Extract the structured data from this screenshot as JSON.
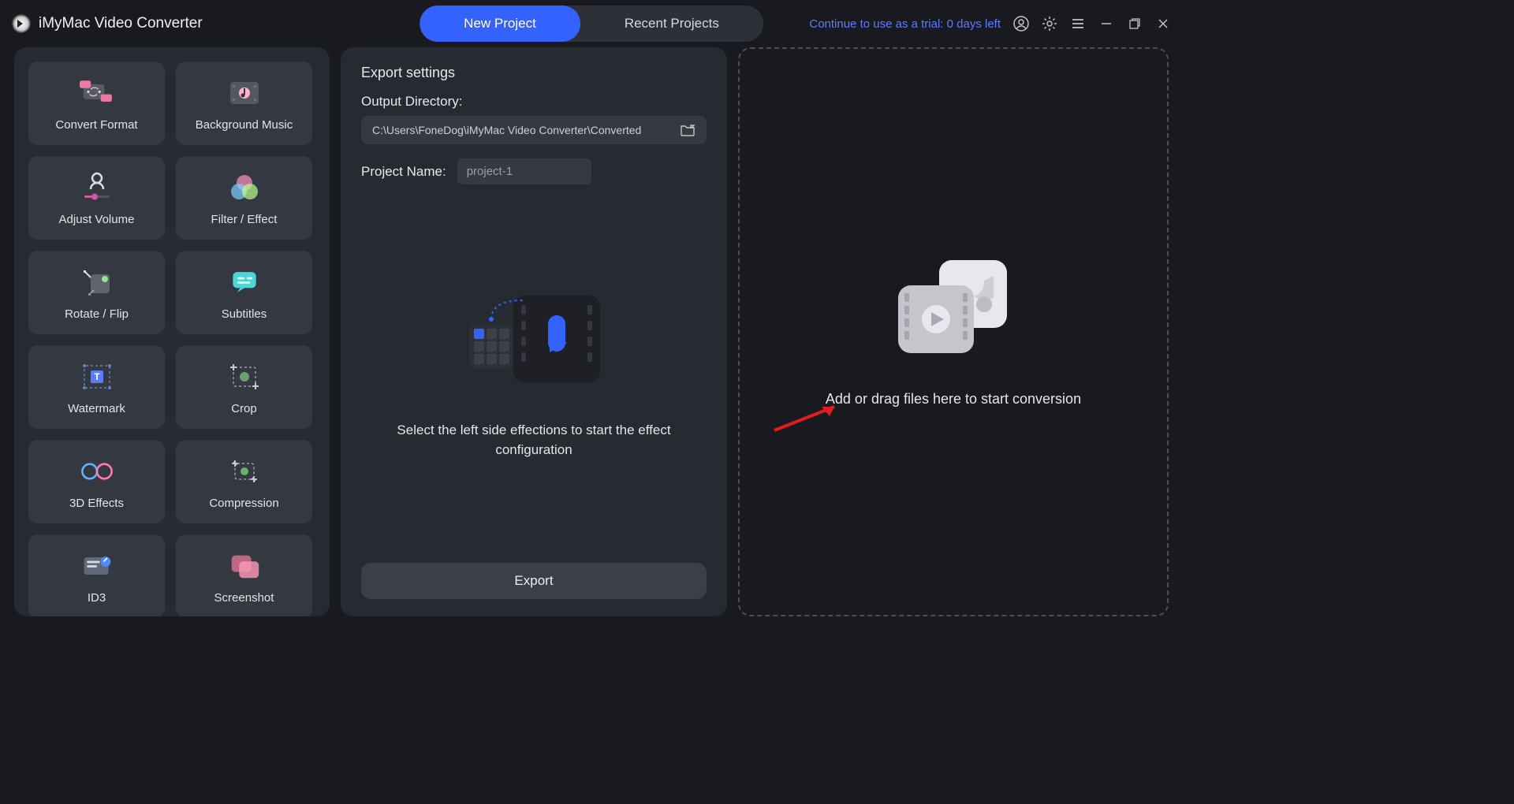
{
  "app": {
    "title": "iMyMac Video Converter"
  },
  "tabs": {
    "new_project": "New Project",
    "recent_projects": "Recent Projects"
  },
  "trial": {
    "text": "Continue to use as a trial: 0 days left"
  },
  "tools": [
    {
      "label": "Convert Format"
    },
    {
      "label": "Background Music"
    },
    {
      "label": "Adjust Volume"
    },
    {
      "label": "Filter / Effect"
    },
    {
      "label": "Rotate / Flip"
    },
    {
      "label": "Subtitles"
    },
    {
      "label": "Watermark"
    },
    {
      "label": "Crop"
    },
    {
      "label": "3D Effects"
    },
    {
      "label": "Compression"
    },
    {
      "label": "ID3"
    },
    {
      "label": "Screenshot"
    }
  ],
  "export": {
    "title": "Export settings",
    "output_dir_label": "Output Directory:",
    "output_dir": "C:\\Users\\FoneDog\\iMyMac Video Converter\\Converted",
    "project_name_label": "Project Name:",
    "project_name": "project-1",
    "hint": "Select the left side effections to start the effect configuration",
    "button": "Export"
  },
  "drop": {
    "hint": "Add or drag files here to start conversion"
  }
}
